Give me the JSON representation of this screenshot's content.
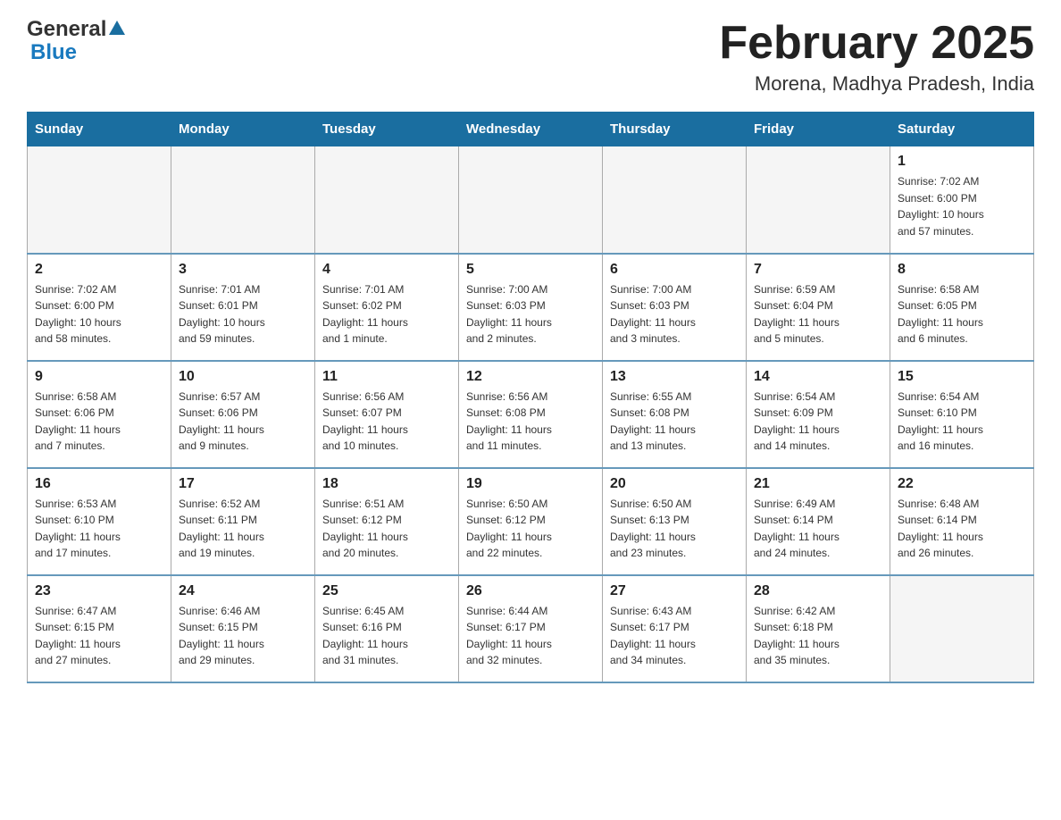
{
  "header": {
    "logo_general": "General",
    "logo_blue": "Blue",
    "title": "February 2025",
    "subtitle": "Morena, Madhya Pradesh, India"
  },
  "days_of_week": [
    "Sunday",
    "Monday",
    "Tuesday",
    "Wednesday",
    "Thursday",
    "Friday",
    "Saturday"
  ],
  "weeks": [
    {
      "days": [
        {
          "num": "",
          "info": ""
        },
        {
          "num": "",
          "info": ""
        },
        {
          "num": "",
          "info": ""
        },
        {
          "num": "",
          "info": ""
        },
        {
          "num": "",
          "info": ""
        },
        {
          "num": "",
          "info": ""
        },
        {
          "num": "1",
          "info": "Sunrise: 7:02 AM\nSunset: 6:00 PM\nDaylight: 10 hours\nand 57 minutes."
        }
      ]
    },
    {
      "days": [
        {
          "num": "2",
          "info": "Sunrise: 7:02 AM\nSunset: 6:00 PM\nDaylight: 10 hours\nand 58 minutes."
        },
        {
          "num": "3",
          "info": "Sunrise: 7:01 AM\nSunset: 6:01 PM\nDaylight: 10 hours\nand 59 minutes."
        },
        {
          "num": "4",
          "info": "Sunrise: 7:01 AM\nSunset: 6:02 PM\nDaylight: 11 hours\nand 1 minute."
        },
        {
          "num": "5",
          "info": "Sunrise: 7:00 AM\nSunset: 6:03 PM\nDaylight: 11 hours\nand 2 minutes."
        },
        {
          "num": "6",
          "info": "Sunrise: 7:00 AM\nSunset: 6:03 PM\nDaylight: 11 hours\nand 3 minutes."
        },
        {
          "num": "7",
          "info": "Sunrise: 6:59 AM\nSunset: 6:04 PM\nDaylight: 11 hours\nand 5 minutes."
        },
        {
          "num": "8",
          "info": "Sunrise: 6:58 AM\nSunset: 6:05 PM\nDaylight: 11 hours\nand 6 minutes."
        }
      ]
    },
    {
      "days": [
        {
          "num": "9",
          "info": "Sunrise: 6:58 AM\nSunset: 6:06 PM\nDaylight: 11 hours\nand 7 minutes."
        },
        {
          "num": "10",
          "info": "Sunrise: 6:57 AM\nSunset: 6:06 PM\nDaylight: 11 hours\nand 9 minutes."
        },
        {
          "num": "11",
          "info": "Sunrise: 6:56 AM\nSunset: 6:07 PM\nDaylight: 11 hours\nand 10 minutes."
        },
        {
          "num": "12",
          "info": "Sunrise: 6:56 AM\nSunset: 6:08 PM\nDaylight: 11 hours\nand 11 minutes."
        },
        {
          "num": "13",
          "info": "Sunrise: 6:55 AM\nSunset: 6:08 PM\nDaylight: 11 hours\nand 13 minutes."
        },
        {
          "num": "14",
          "info": "Sunrise: 6:54 AM\nSunset: 6:09 PM\nDaylight: 11 hours\nand 14 minutes."
        },
        {
          "num": "15",
          "info": "Sunrise: 6:54 AM\nSunset: 6:10 PM\nDaylight: 11 hours\nand 16 minutes."
        }
      ]
    },
    {
      "days": [
        {
          "num": "16",
          "info": "Sunrise: 6:53 AM\nSunset: 6:10 PM\nDaylight: 11 hours\nand 17 minutes."
        },
        {
          "num": "17",
          "info": "Sunrise: 6:52 AM\nSunset: 6:11 PM\nDaylight: 11 hours\nand 19 minutes."
        },
        {
          "num": "18",
          "info": "Sunrise: 6:51 AM\nSunset: 6:12 PM\nDaylight: 11 hours\nand 20 minutes."
        },
        {
          "num": "19",
          "info": "Sunrise: 6:50 AM\nSunset: 6:12 PM\nDaylight: 11 hours\nand 22 minutes."
        },
        {
          "num": "20",
          "info": "Sunrise: 6:50 AM\nSunset: 6:13 PM\nDaylight: 11 hours\nand 23 minutes."
        },
        {
          "num": "21",
          "info": "Sunrise: 6:49 AM\nSunset: 6:14 PM\nDaylight: 11 hours\nand 24 minutes."
        },
        {
          "num": "22",
          "info": "Sunrise: 6:48 AM\nSunset: 6:14 PM\nDaylight: 11 hours\nand 26 minutes."
        }
      ]
    },
    {
      "days": [
        {
          "num": "23",
          "info": "Sunrise: 6:47 AM\nSunset: 6:15 PM\nDaylight: 11 hours\nand 27 minutes."
        },
        {
          "num": "24",
          "info": "Sunrise: 6:46 AM\nSunset: 6:15 PM\nDaylight: 11 hours\nand 29 minutes."
        },
        {
          "num": "25",
          "info": "Sunrise: 6:45 AM\nSunset: 6:16 PM\nDaylight: 11 hours\nand 31 minutes."
        },
        {
          "num": "26",
          "info": "Sunrise: 6:44 AM\nSunset: 6:17 PM\nDaylight: 11 hours\nand 32 minutes."
        },
        {
          "num": "27",
          "info": "Sunrise: 6:43 AM\nSunset: 6:17 PM\nDaylight: 11 hours\nand 34 minutes."
        },
        {
          "num": "28",
          "info": "Sunrise: 6:42 AM\nSunset: 6:18 PM\nDaylight: 11 hours\nand 35 minutes."
        },
        {
          "num": "",
          "info": ""
        }
      ]
    }
  ]
}
